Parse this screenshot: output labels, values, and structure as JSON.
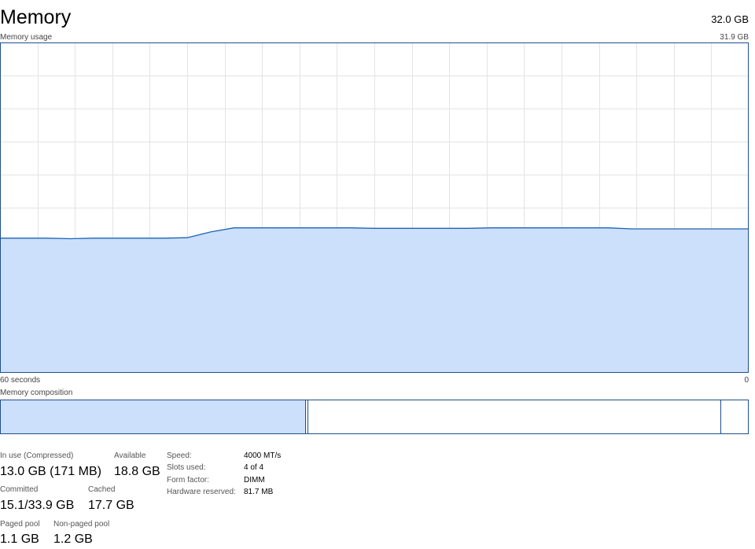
{
  "header": {
    "title": "Memory",
    "total": "32.0 GB"
  },
  "graph": {
    "label": "Memory usage",
    "max_label": "31.9 GB",
    "x_left_label": "60 seconds",
    "x_right_label": "0",
    "max_gb": 31.9,
    "usage_gb": [
      13.0,
      13.0,
      13.0,
      12.95,
      13.0,
      13.0,
      13.0,
      13.0,
      13.05,
      13.6,
      14.0,
      14.0,
      14.0,
      14.0,
      14.0,
      14.0,
      13.95,
      13.95,
      13.95,
      13.95,
      13.95,
      14.0,
      14.0,
      14.0,
      14.0,
      14.0,
      14.0,
      13.9,
      13.9,
      13.9,
      13.9,
      13.9,
      13.9
    ],
    "fill_color": "#cce0fb",
    "line_color": "#1b64b5"
  },
  "composition": {
    "label": "Memory composition",
    "in_use_fraction": 0.408,
    "modified_fraction": 0.0035,
    "standby_fraction": 0.553,
    "free_fraction": 0.0355
  },
  "stats": {
    "in_use_label": "In use (Compressed)",
    "in_use_value": "13.0 GB (171 MB)",
    "available_label": "Available",
    "available_value": "18.8 GB",
    "committed_label": "Committed",
    "committed_value": "15.1/33.9 GB",
    "cached_label": "Cached",
    "cached_value": "17.7 GB",
    "paged_label": "Paged pool",
    "paged_value": "1.1 GB",
    "nonpaged_label": "Non-paged pool",
    "nonpaged_value": "1.2 GB"
  },
  "details": [
    {
      "label": "Speed:",
      "value": "4000 MT/s"
    },
    {
      "label": "Slots used:",
      "value": "4 of 4"
    },
    {
      "label": "Form factor:",
      "value": "DIMM"
    },
    {
      "label": "Hardware reserved:",
      "value": "81.7 MB"
    }
  ]
}
